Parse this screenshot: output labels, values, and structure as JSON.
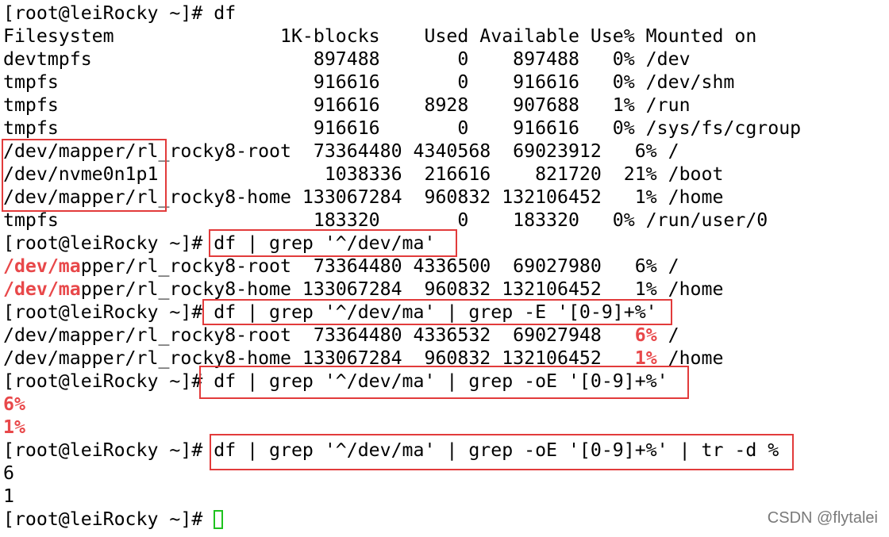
{
  "terminal": {
    "lines": [
      "[root@leiRocky ~]# df",
      "Filesystem               1K-blocks    Used Available Use% Mounted on",
      "devtmpfs                    897488       0    897488   0% /dev",
      "tmpfs                       916616       0    916616   0% /dev/shm",
      "tmpfs                       916616    8928    907688   1% /run",
      "tmpfs                       916616       0    916616   0% /sys/fs/cgroup",
      "/dev/mapper/rl_rocky8-root  73364480 4340568  69023912   6% /",
      "/dev/nvme0n1p1               1038336  216616    821720  21% /boot",
      "/dev/mapper/rl_rocky8-home 133067284  960832 132106452   1% /home",
      "tmpfs                       183320       0    183320   0% /run/user/0",
      "[root@leiRocky ~]# df | grep '^/dev/ma'",
      {
        "hl": "/dev/ma",
        "rest": "pper/rl_rocky8-root  73364480 4336500  69027980   6% /"
      },
      {
        "hl": "/dev/ma",
        "rest": "pper/rl_rocky8-home 133067284  960832 132106452   1% /home"
      },
      "[root@leiRocky ~]# df | grep '^/dev/ma' | grep -E '[0-9]+%'",
      {
        "pre": "/dev/mapper/rl_rocky8-root  73364480 4336532  69027948   ",
        "hl": "6%",
        "rest": " /"
      },
      {
        "pre": "/dev/mapper/rl_rocky8-home 133067284  960832 132106452   ",
        "hl": "1%",
        "rest": " /home"
      },
      "[root@leiRocky ~]# df | grep '^/dev/ma' | grep -oE '[0-9]+%'",
      {
        "hl": "6%"
      },
      {
        "hl": "1%"
      },
      "[root@leiRocky ~]# df | grep '^/dev/ma' | grep -oE '[0-9]+%' | tr -d %",
      "6",
      "1",
      "[root@leiRocky ~]# "
    ]
  },
  "watermark": "CSDN @flytalei",
  "colors": {
    "background": "#ffffff",
    "text": "#000000",
    "match_highlight": "#e8484a",
    "annotation_box": "#e23b3b",
    "cursor": "#1ec21e"
  }
}
